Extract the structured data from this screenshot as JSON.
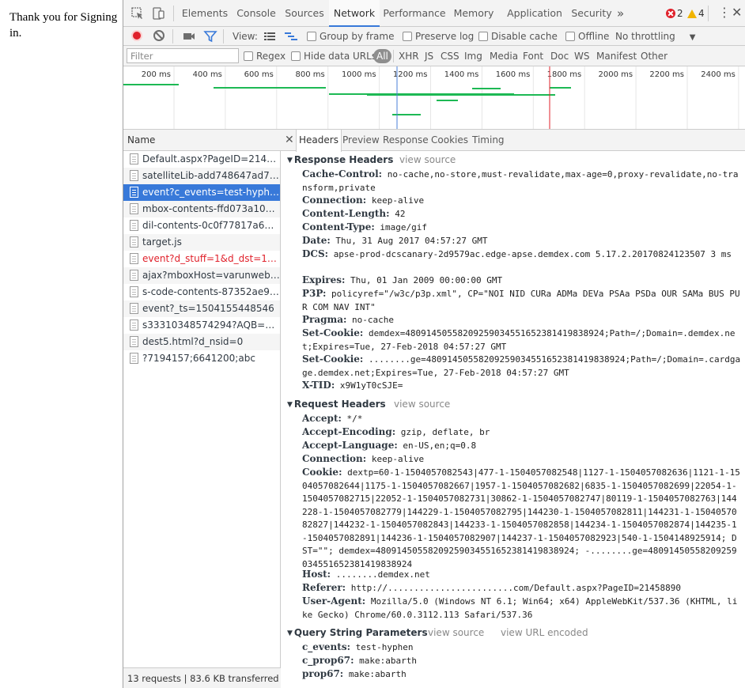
{
  "page": {
    "text": "Thank you for Signing in."
  },
  "main_tabs": [
    {
      "label": "Elements"
    },
    {
      "label": "Console"
    },
    {
      "label": "Sources"
    },
    {
      "label": "Network",
      "active": true
    },
    {
      "label": "Performance"
    },
    {
      "label": "Memory"
    },
    {
      "label": "Application"
    },
    {
      "label": "Security"
    }
  ],
  "overflow": "»",
  "errors_count": "2",
  "warnings_count": "4",
  "toolbar": {
    "view_label": "View:",
    "group_by_frame": "Group by frame",
    "preserve_log": "Preserve log",
    "disable_cache": "Disable cache",
    "offline": "Offline",
    "throttling": "No throttling"
  },
  "filter": {
    "placeholder": "Filter",
    "regex": "Regex",
    "hide_data_urls": "Hide data URLs",
    "types": [
      "All",
      "XHR",
      "JS",
      "CSS",
      "Img",
      "Media",
      "Font",
      "Doc",
      "WS",
      "Manifest",
      "Other"
    ]
  },
  "timeline_ticks": [
    "200 ms",
    "400 ms",
    "600 ms",
    "800 ms",
    "1000 ms",
    "1200 ms",
    "1400 ms",
    "1600 ms",
    "1800 ms",
    "2000 ms",
    "2200 ms",
    "2400 ms"
  ],
  "colors": {
    "accent": "#3879d9",
    "error": "#e0212b",
    "warning": "#f1b400",
    "bar": "#1db954",
    "domline": "#4a7fd8",
    "loadline": "#e0212b"
  },
  "requests": {
    "column_name": "Name",
    "items": [
      {
        "name": "Default.aspx?PageID=21458890"
      },
      {
        "name": "satelliteLib-add748647ad714c..."
      },
      {
        "name": "event?c_events=test-hyphen&...",
        "selected": true
      },
      {
        "name": "mbox-contents-ffd073a10c1b..."
      },
      {
        "name": "dil-contents-0c0f77817a61160..."
      },
      {
        "name": "target.js"
      },
      {
        "name": "event?d_stuff=1&d_dst=1&d_...",
        "error": true
      },
      {
        "name": "ajax?mboxHost=varunweb.wo..."
      },
      {
        "name": "s-code-contents-87352ae938a..."
      },
      {
        "name": "event?_ts=1504155448546"
      },
      {
        "name": "s33310348574294?AQB=1&n..."
      },
      {
        "name": "dest5.html?d_nsid=0"
      },
      {
        "name": "?7194157;6641200;abc"
      }
    ],
    "status": "13 requests | 83.6 KB transferred ..."
  },
  "detail_tabs": [
    "Headers",
    "Preview",
    "Response",
    "Cookies",
    "Timing"
  ],
  "response_headers": {
    "title": "Response Headers",
    "view_source": "view source",
    "items": [
      {
        "name": "Cache-Control:",
        "value": "no-cache,no-store,must-revalidate,max-age=0,proxy-revalidate,no-transform,private"
      },
      {
        "name": "Connection:",
        "value": "keep-alive"
      },
      {
        "name": "Content-Length:",
        "value": "42"
      },
      {
        "name": "Content-Type:",
        "value": "image/gif"
      },
      {
        "name": "Date:",
        "value": "Thu, 31 Aug 2017 04:57:27 GMT"
      },
      {
        "name": "DCS:",
        "value": "apse-prod-dcscanary-2d9579ac.edge-apse.demdex.com 5.17.2.20170824123507 3 ms"
      },
      {
        "name": "Expires:",
        "value": "Thu, 01 Jan 2009 00:00:00 GMT"
      },
      {
        "name": "P3P:",
        "value": "policyref=\"/w3c/p3p.xml\", CP=\"NOI NID CURa ADMa DEVa PSAa PSDa OUR SAMa BUS PUR COM NAV INT\""
      },
      {
        "name": "Pragma:",
        "value": "no-cache"
      },
      {
        "name": "Set-Cookie:",
        "value": "demdex=48091450558209259034551652381419838924;Path=/;Domain=.demdex.net;Expires=Tue, 27-Feb-2018 04:57:27 GMT"
      },
      {
        "name": "Set-Cookie:",
        "value": "........ge=48091450558209259034551652381419838924;Path=/;Domain=.cardgage.demdex.net;Expires=Tue, 27-Feb-2018 04:57:27 GMT"
      },
      {
        "name": "X-TID:",
        "value": "x9W1yT0cSJE="
      }
    ]
  },
  "request_headers": {
    "title": "Request Headers",
    "view_source": "view source",
    "items": [
      {
        "name": "Accept:",
        "value": "*/*"
      },
      {
        "name": "Accept-Encoding:",
        "value": "gzip, deflate, br"
      },
      {
        "name": "Accept-Language:",
        "value": "en-US,en;q=0.8"
      },
      {
        "name": "Connection:",
        "value": "keep-alive"
      },
      {
        "name": "Cookie:",
        "value": "dextp=60-1-1504057082543|477-1-1504057082548|1127-1-1504057082636|1121-1-1504057082644|1175-1-1504057082667|1957-1-1504057082682|6835-1-1504057082699|22054-1-1504057082715|22052-1-1504057082731|30862-1-1504057082747|80119-1-1504057082763|144228-1-1504057082779|144229-1-1504057082795|144230-1-1504057082811|144231-1-1504057082827|144232-1-1504057082843|144233-1-1504057082858|144234-1-1504057082874|144235-1-1504057082891|144236-1-1504057082907|144237-1-1504057082923|540-1-1504148925914; DST=\"\"; demdex=48091450558209259034551652381419838924;  -........ge=48091450558209259034551652381419838924"
      },
      {
        "name": "Host:",
        "value": "........demdex.net"
      },
      {
        "name": "Referer:",
        "value": "http://........................com/Default.aspx?PageID=21458890"
      },
      {
        "name": "User-Agent:",
        "value": "Mozilla/5.0 (Windows NT 6.1; Win64; x64) AppleWebKit/537.36 (KHTML, like Gecko) Chrome/60.0.3112.113 Safari/537.36"
      }
    ]
  },
  "query_params": {
    "title": "Query String Parameters",
    "view_source": "view source",
    "view_url_encoded": "view URL encoded",
    "items": [
      {
        "name": "c_events:",
        "value": "test-hyphen"
      },
      {
        "name": "c_prop67:",
        "value": "make:abarth"
      },
      {
        "name": "prop67:",
        "value": "make:abarth"
      }
    ]
  }
}
